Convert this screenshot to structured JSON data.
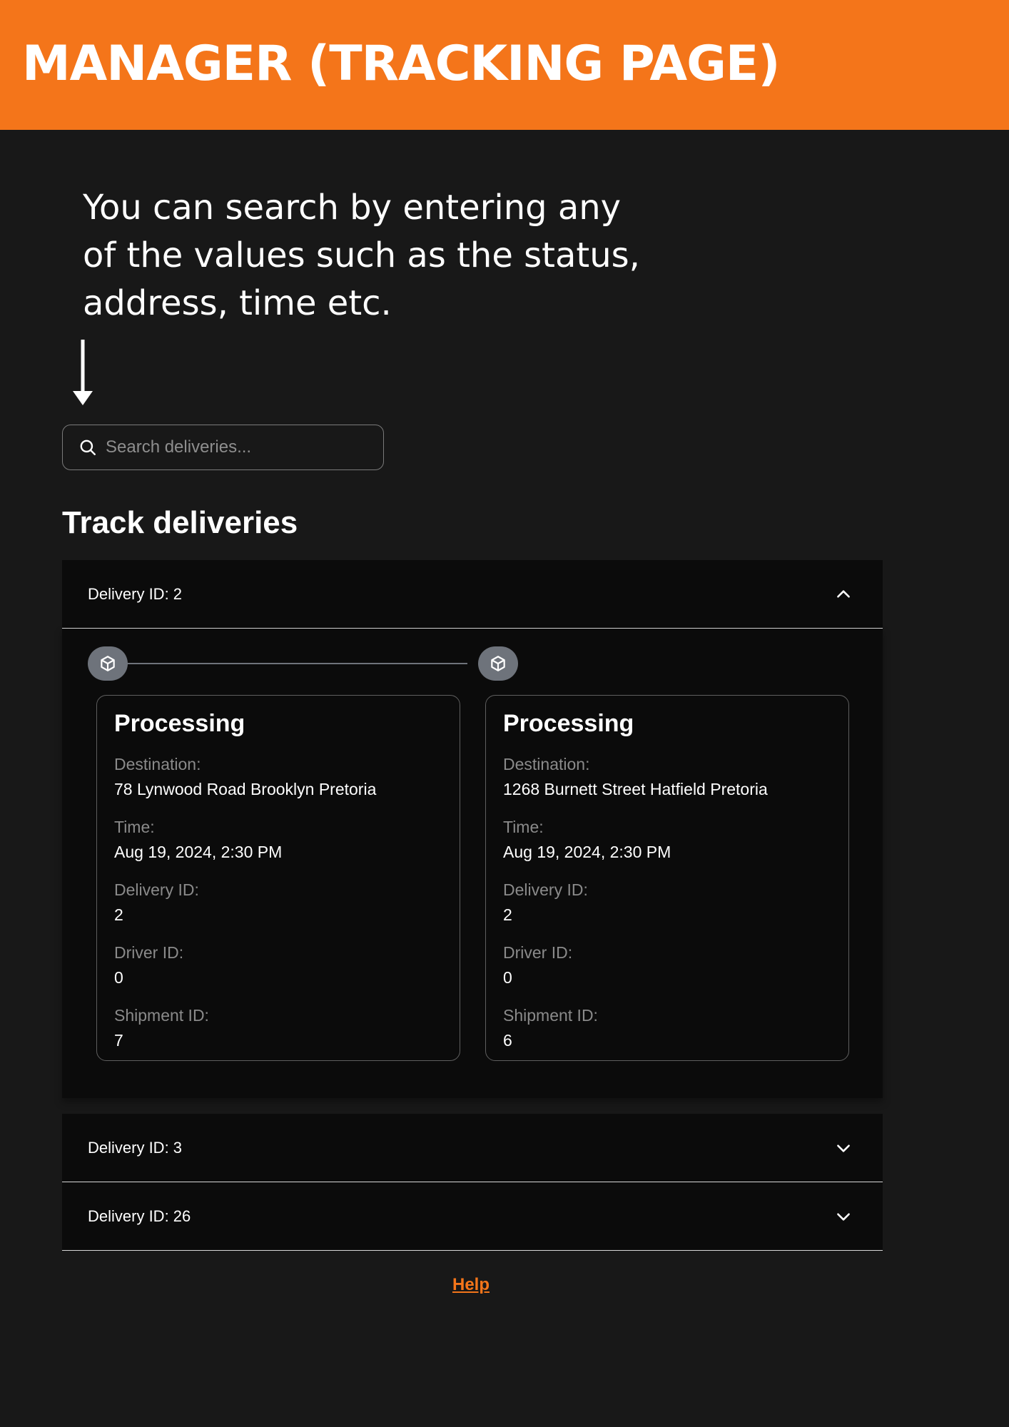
{
  "banner": {
    "title": "MANAGER (TRACKING PAGE)"
  },
  "instruction": {
    "lines": [
      "You can search by entering any",
      "of the values such as the status,",
      "address, time etc."
    ]
  },
  "search": {
    "placeholder": "Search deliveries..."
  },
  "section_title": "Track deliveries",
  "deliveries": [
    {
      "header": "Delivery ID: 2",
      "expanded": true,
      "cards": [
        {
          "status": "Processing",
          "destination_label": "Destination:",
          "destination": "78 Lynwood Road Brooklyn Pretoria",
          "time_label": "Time:",
          "time": "Aug 19, 2024, 2:30 PM",
          "delivery_id_label": "Delivery ID:",
          "delivery_id": "2",
          "driver_id_label": "Driver ID:",
          "driver_id": "0",
          "shipment_id_label": "Shipment ID:",
          "shipment_id": "7"
        },
        {
          "status": "Processing",
          "destination_label": "Destination:",
          "destination": "1268 Burnett Street Hatfield Pretoria",
          "time_label": "Time:",
          "time": "Aug 19, 2024, 2:30 PM",
          "delivery_id_label": "Delivery ID:",
          "delivery_id": "2",
          "driver_id_label": "Driver ID:",
          "driver_id": "0",
          "shipment_id_label": "Shipment ID:",
          "shipment_id": "6"
        }
      ]
    },
    {
      "header": "Delivery ID: 3",
      "expanded": false
    },
    {
      "header": "Delivery ID: 26",
      "expanded": false
    }
  ],
  "footer": {
    "help_label": "Help"
  },
  "icons": {
    "search": "search-icon",
    "chevron_up": "chevron-up-icon",
    "chevron_down": "chevron-down-icon",
    "package": "package-icon",
    "arrow": "arrow-down-icon"
  },
  "colors": {
    "accent": "#f4751a",
    "background": "#181818",
    "panel": "#0b0b0b",
    "timeline": "#6e737b"
  }
}
